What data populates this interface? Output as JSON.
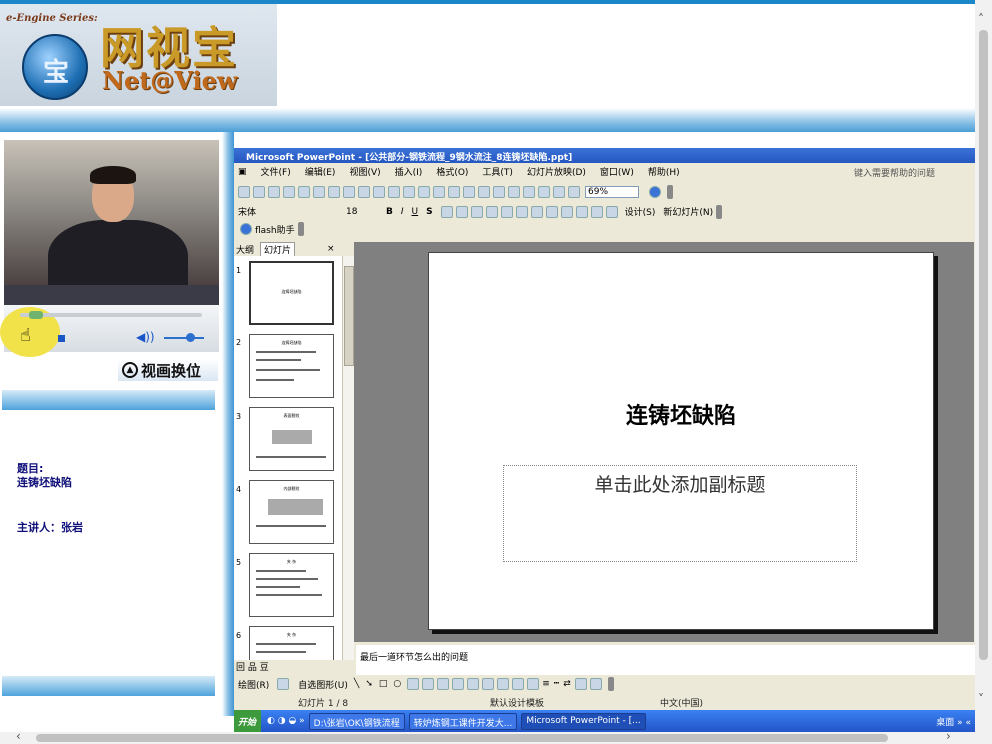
{
  "logo": {
    "series_tag": "e-Engine Series:",
    "globe_char": "宝",
    "name_cn": "网视宝",
    "name_en": "Net@View"
  },
  "player": {
    "swap_label": "视画换位",
    "progress": 0.05
  },
  "lecture": {
    "topic_label": "题目:",
    "topic": "连铸坯缺陷",
    "speaker": "主讲人：张岩"
  },
  "powerpoint": {
    "window_title": "Microsoft PowerPoint - [公共部分-钢铁流程_9钢水流注_8连铸坯缺陷.ppt]",
    "menus": [
      "文件(F)",
      "编辑(E)",
      "视图(V)",
      "插入(I)",
      "格式(O)",
      "工具(T)",
      "幻灯片放映(D)",
      "窗口(W)",
      "帮助(H)"
    ],
    "help_placeholder": "键入需要帮助的问题",
    "zoom": "69%",
    "font_name": "宋体",
    "font_size": "18",
    "design_btn": "设计(S)",
    "new_slide_btn": "新幻灯片(N)",
    "flash_helper": "flash助手",
    "tab_outline": "大纲",
    "tab_slides": "幻灯片",
    "tab_close": "×",
    "thumbnails": [
      {
        "num": "1",
        "title": "连铸坯缺陷"
      },
      {
        "num": "2",
        "title": "连铸坯缺陷"
      },
      {
        "num": "3",
        "title": "表面裂纹"
      },
      {
        "num": "4",
        "title": "内部裂纹"
      },
      {
        "num": "5",
        "title": "夹 杂"
      },
      {
        "num": "6",
        "title": "夹 杂"
      }
    ],
    "slide_title": "连铸坯缺陷",
    "subtitle_placeholder": "单击此处添加副标题",
    "notes": "最后一道环节怎么出的问题",
    "draw_label": "绘图(R)",
    "autoshapes_label": "自选图形(U)",
    "status_slide": "幻灯片 1 / 8",
    "status_template": "默认设计模板",
    "status_lang": "中文(中国)"
  },
  "taskbar": {
    "start": "开始",
    "tasks": [
      "D:\\张岩\\OK\\钢铁流程",
      "转炉炼钢工课件开发大...",
      "Microsoft PowerPoint - [..."
    ],
    "tray": "桌面"
  }
}
